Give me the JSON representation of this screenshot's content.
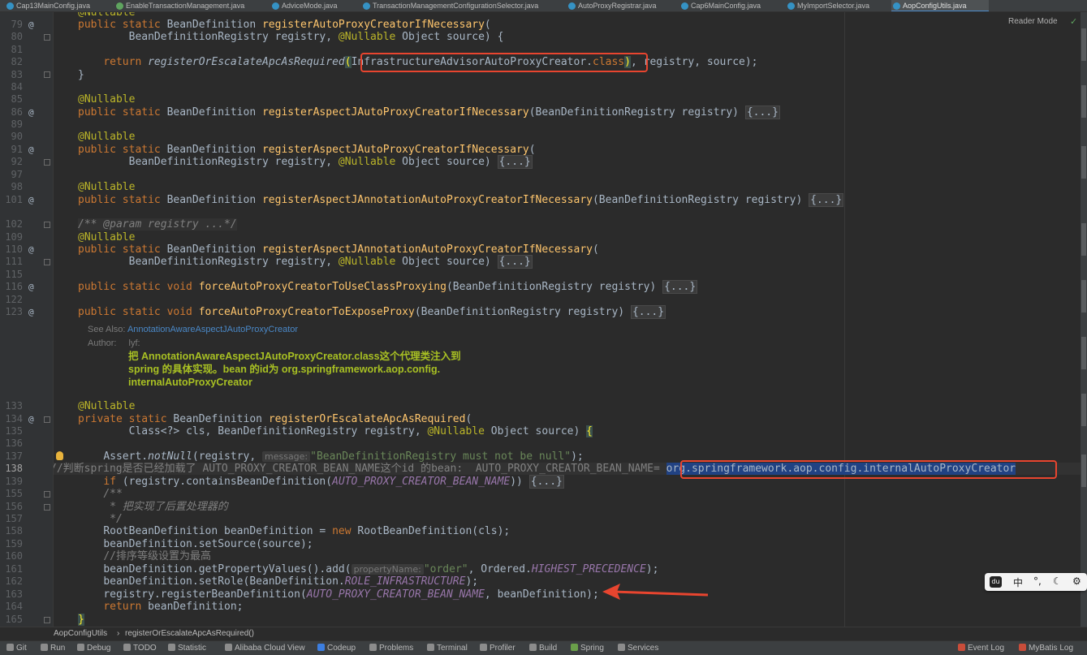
{
  "tabs": [
    {
      "label": "Cap13MainConfig.java",
      "kind": "class"
    },
    {
      "label": "EnableTransactionManagement.java",
      "kind": "iface"
    },
    {
      "label": "AdviceMode.java",
      "kind": "class"
    },
    {
      "label": "TransactionManagementConfigurationSelector.java",
      "kind": "class"
    },
    {
      "label": "AutoProxyRegistrar.java",
      "kind": "class"
    },
    {
      "label": "Cap6MainConfig.java",
      "kind": "class"
    },
    {
      "label": "MyImportSelector.java",
      "kind": "class"
    },
    {
      "label": "AopConfigUtils.java",
      "kind": "class",
      "active": true
    }
  ],
  "reader_mode": "Reader Mode",
  "line_numbers": [
    "79",
    "80",
    "81",
    "82",
    "83",
    "84",
    "85",
    "86",
    "89",
    "90",
    "91",
    "92",
    "97",
    "98",
    "101",
    "102",
    "109",
    "110",
    "111",
    "115",
    "116",
    "122",
    "123",
    "133",
    "134",
    "135",
    "136",
    "137",
    "138",
    "139",
    "155",
    "156",
    "157",
    "158",
    "159",
    "160",
    "161",
    "162",
    "163",
    "164",
    "165"
  ],
  "doc": {
    "see_also_label": "See Also:",
    "see_also_link": "AnnotationAwareAspectJAutoProxyCreator",
    "author_label": "Author:",
    "author": "lyf:",
    "body1": "把 AnnotationAwareAspectJAutoProxyCreator.class这个代理类注入到",
    "body2": "spring 的具体实现。bean 的id为 org.springframework.aop.config.",
    "body3": "internalAutoProxyCreator"
  },
  "code": {
    "top_partial": "@Nullable",
    "l79_kw": "public static",
    "l79_type": " BeanDefinition ",
    "l79_method": "registerAutoProxyCreatorIfNecessary",
    "l79_rest": "(",
    "l80_a": "BeanDefinitionRegistry registry, ",
    "l80_an": "@Nullable",
    "l80_b": " Object source) {",
    "l82_kw": "return",
    "l82_call": "registerOrEscalateApcAsRequired",
    "l82_arg": "InfrastructureAdvisorAutoProxyCreator.",
    "l82_class": "class",
    "l82_rest": ", registry, source);",
    "l83": "}",
    "nullable": "@Nullable",
    "l86_method": "registerAspectJAutoProxyCreatorIfNecessary",
    "l86_rest": "(BeanDefinitionRegistry registry) ",
    "fold": "{...}",
    "l90_method": "registerAspectJAutoProxyCreatorIfNecessary",
    "paren": "(",
    "l91_b": " Object source) ",
    "l98_method": "registerAspectJAnnotationAutoProxyCreatorIfNecessary",
    "l102": "/** @param registry ...*/",
    "l110_method": "registerAspectJAnnotationAutoProxyCreatorIfNecessary",
    "kw_public_static_void": "public static void",
    "l116_method": "forceAutoProxyCreatorToUseClassProxying",
    "l123_method": "forceAutoProxyCreatorToExposeProxy",
    "l134_kw": "private static",
    "l134_method": "registerOrEscalateApcAsRequired",
    "l135_a": "Class<?> cls, BeanDefinitionRegistry registry, ",
    "l135_b": " Object source) ",
    "brace_open": "{",
    "l137_a": "Assert.",
    "l137_m": "notNull",
    "l137_b": "(registry, ",
    "hint_message": "message:",
    "l137_str": "\"BeanDefinitionRegistry must not be null\"",
    "l137_c": ");",
    "l138_comment": "//判断spring是否已经加载了 AUTO_PROXY_CREATOR_BEAN_NAME这个id 的bean:  AUTO_PROXY_CREATOR_BEAN_NAME= ",
    "l138_sel": "org.springframework.aop.config.internalAutoProxyCreator",
    "l139_kw": "if",
    "l139_a": " (registry.containsBeanDefinition(",
    "l139_const": "AUTO_PROXY_CREATOR_BEAN_NAME",
    "l139_b": ")) ",
    "l155": "/**",
    "l156": " * 把实现了后置处理器的",
    "l157": " */",
    "l158_a": "RootBeanDefinition beanDefinition = ",
    "l158_kw": "new",
    "l158_b": " RootBeanDefinition(cls);",
    "l159": "beanDefinition.setSource(source);",
    "l160": "//排序等级设置为最高",
    "l161_a": "beanDefinition.getPropertyValues().add(",
    "hint_property": "propertyName:",
    "l161_str": "\"order\"",
    "l161_b": ", Ordered.",
    "l161_const": "HIGHEST_PRECEDENCE",
    "l161_c": ");",
    "l162_a": "beanDefinition.setRole(BeanDefinition.",
    "l162_const": "ROLE_INFRASTRUCTURE",
    "l162_b": ");",
    "l163_a": "registry.registerBeanDefinition(",
    "l163_const": "AUTO_PROXY_CREATOR_BEAN_NAME",
    "l163_b": ", beanDefinition);",
    "l164_kw": "return",
    "l164_b": " beanDefinition;",
    "l165": "}",
    "type_bd": " BeanDefinition ",
    "l80_indent_a": "BeanDefinitionRegistry registry, "
  },
  "breadcrumb": {
    "file": "AopConfigUtils",
    "method": "registerOrEscalateApcAsRequired()"
  },
  "tool_windows": [
    "Git",
    "Run",
    "Debug",
    "TODO",
    "Statistic",
    "Alibaba Cloud View",
    "Codeup",
    "Problems",
    "Terminal",
    "Profiler",
    "Build",
    "Spring",
    "Services",
    "Event Log",
    "MyBatis Log"
  ],
  "ime": {
    "logo": "du",
    "zh": "中",
    "punct": "°,"
  },
  "colors": {
    "keyword": "#cc7832",
    "annotation": "#bbb529",
    "method": "#ffc66d",
    "string": "#6a8759",
    "constant": "#9876aa",
    "highlight_box": "#e8452f",
    "selection": "#214283"
  }
}
